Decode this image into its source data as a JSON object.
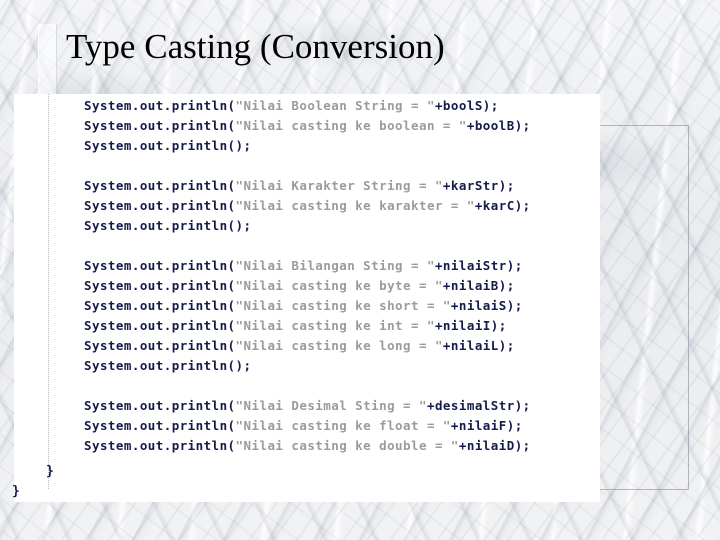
{
  "slide": {
    "title": "Type Casting (Conversion)",
    "background": "marble-texture",
    "panel_background": "#ffffff",
    "code_color": "#141a4a",
    "string_color": "#9b9b9b"
  },
  "code": {
    "lines": [
      {
        "type": "code",
        "prefix": "System.out.println(",
        "string": "\"Nilai Boolean String = \"",
        "suffix": "+boolS);"
      },
      {
        "type": "code",
        "prefix": "System.out.println(",
        "string": "\"Nilai casting ke boolean = \"",
        "suffix": "+boolB);"
      },
      {
        "type": "code",
        "prefix": "System.out.println(",
        "string": "",
        "suffix": ");"
      },
      {
        "type": "blank",
        "prefix": "",
        "string": "",
        "suffix": ""
      },
      {
        "type": "code",
        "prefix": "System.out.println(",
        "string": "\"Nilai Karakter String = \"",
        "suffix": "+karStr);"
      },
      {
        "type": "code",
        "prefix": "System.out.println(",
        "string": "\"Nilai casting ke karakter = \"",
        "suffix": "+karC);"
      },
      {
        "type": "code",
        "prefix": "System.out.println(",
        "string": "",
        "suffix": ");"
      },
      {
        "type": "blank",
        "prefix": "",
        "string": "",
        "suffix": ""
      },
      {
        "type": "code",
        "prefix": "System.out.println(",
        "string": "\"Nilai Bilangan Sting = \"",
        "suffix": "+nilaiStr);"
      },
      {
        "type": "code",
        "prefix": "System.out.println(",
        "string": "\"Nilai casting ke byte = \"",
        "suffix": "+nilaiB);"
      },
      {
        "type": "code",
        "prefix": "System.out.println(",
        "string": "\"Nilai casting ke short = \"",
        "suffix": "+nilaiS);"
      },
      {
        "type": "code",
        "prefix": "System.out.println(",
        "string": "\"Nilai casting ke int = \"",
        "suffix": "+nilaiI);"
      },
      {
        "type": "code",
        "prefix": "System.out.println(",
        "string": "\"Nilai casting ke long = \"",
        "suffix": "+nilaiL);"
      },
      {
        "type": "code",
        "prefix": "System.out.println(",
        "string": "",
        "suffix": ");"
      },
      {
        "type": "blank",
        "prefix": "",
        "string": "",
        "suffix": ""
      },
      {
        "type": "code",
        "prefix": "System.out.println(",
        "string": "\"Nilai Desimal Sting = \"",
        "suffix": "+desimalStr);"
      },
      {
        "type": "code",
        "prefix": "System.out.println(",
        "string": "\"Nilai casting ke float = \"",
        "suffix": "+nilaiF);"
      },
      {
        "type": "code",
        "prefix": "System.out.println(",
        "string": "\"Nilai casting ke double = \"",
        "suffix": "+nilaiD);"
      }
    ],
    "closing_brace_inner": "}",
    "closing_brace_outer": "}"
  }
}
